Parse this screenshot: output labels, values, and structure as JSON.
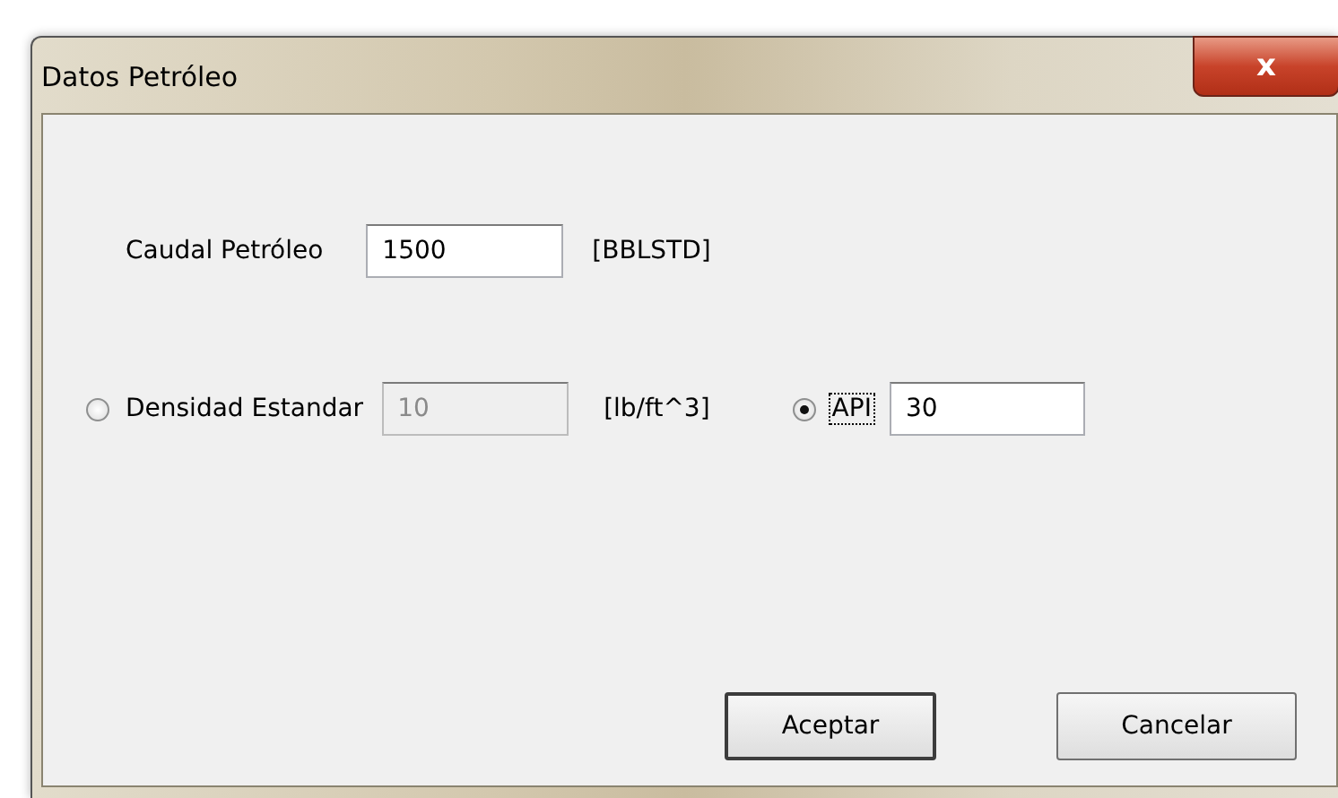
{
  "window": {
    "title": "Datos Petróleo",
    "close": "x"
  },
  "flow_rate": {
    "label": "Caudal Petróleo",
    "value": "1500",
    "unit": "[BBLSTD]"
  },
  "density_options": [
    {
      "label": "Densidad Estandar",
      "selected": false,
      "value": "10",
      "disabled": true,
      "unit": "[lb/ft^3]",
      "focused": false
    },
    {
      "label": "API",
      "selected": true,
      "value": "30",
      "disabled": false,
      "focused": true
    }
  ],
  "buttons": [
    {
      "label": "Aceptar",
      "default": true
    },
    {
      "label": "Cancelar",
      "default": false
    }
  ]
}
